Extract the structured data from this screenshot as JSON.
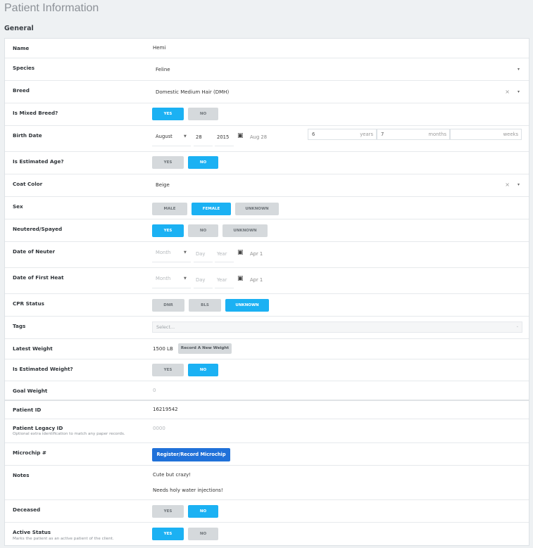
{
  "page_title": "Patient Information",
  "section_title": "General",
  "fields": {
    "name": {
      "label": "Name",
      "value": "Hemi"
    },
    "species": {
      "label": "Species",
      "value": "Feline"
    },
    "breed": {
      "label": "Breed",
      "value": "Domestic Medium Hair (DMH)"
    },
    "mixed_breed": {
      "label": "Is Mixed Breed?",
      "options": [
        "YES",
        "NO"
      ],
      "selected": "YES"
    },
    "birth_date": {
      "label": "Birth Date",
      "month": "August",
      "day": "28",
      "year": "2015",
      "display": "Aug 28",
      "age_years": "6",
      "age_years_unit": "years",
      "age_months": "7",
      "age_months_unit": "months",
      "age_weeks": "",
      "age_weeks_unit": "weeks"
    },
    "estimated_age": {
      "label": "Is Estimated Age?",
      "options": [
        "YES",
        "NO"
      ],
      "selected": "NO"
    },
    "coat_color": {
      "label": "Coat Color",
      "value": "Beige"
    },
    "sex": {
      "label": "Sex",
      "options": [
        "MALE",
        "FEMALE",
        "UNKNOWN"
      ],
      "selected": "FEMALE"
    },
    "neutered": {
      "label": "Neutered/Spayed",
      "options": [
        "YES",
        "NO",
        "UNKNOWN"
      ],
      "selected": "YES"
    },
    "date_of_neuter": {
      "label": "Date of Neuter",
      "month_ph": "Month",
      "day_ph": "Day",
      "year_ph": "Year",
      "display": "Apr 1"
    },
    "date_first_heat": {
      "label": "Date of First Heat",
      "month_ph": "Month",
      "day_ph": "Day",
      "year_ph": "Year",
      "display": "Apr 1"
    },
    "cpr_status": {
      "label": "CPR Status",
      "options": [
        "DNR",
        "BLS",
        "UNKNOWN"
      ],
      "selected": "UNKNOWN"
    },
    "tags": {
      "label": "Tags",
      "placeholder": "Select..."
    },
    "latest_weight": {
      "label": "Latest Weight",
      "value": "1500 LB",
      "button": "Record A New Weight"
    },
    "estimated_weight": {
      "label": "Is Estimated Weight?",
      "options": [
        "YES",
        "NO"
      ],
      "selected": "NO"
    },
    "goal_weight": {
      "label": "Goal Weight",
      "placeholder": "0"
    },
    "patient_id": {
      "label": "Patient ID",
      "value": "16219542"
    },
    "legacy_id": {
      "label": "Patient Legacy ID",
      "sublabel": "Optional extra identification to match any paper records.",
      "placeholder": "0000"
    },
    "microchip": {
      "label": "Microchip #",
      "button": "Register/Record Microchip"
    },
    "notes": {
      "label": "Notes",
      "lines": [
        "Cute but crazy!",
        "Needs holy water injections!"
      ]
    },
    "deceased": {
      "label": "Deceased",
      "options": [
        "YES",
        "NO"
      ],
      "selected": "NO"
    },
    "active_status": {
      "label": "Active Status",
      "sublabel": "Marks the patient as an active patient of the client.",
      "options": [
        "YES",
        "NO"
      ],
      "selected": "YES"
    }
  },
  "icons": {
    "calendar": "calendar-icon",
    "caret": "chevron-down-icon",
    "clear": "close-icon"
  },
  "colors": {
    "accent": "#1bb1f3",
    "primary": "#2071d9",
    "inactive": "#d5d9dc"
  }
}
